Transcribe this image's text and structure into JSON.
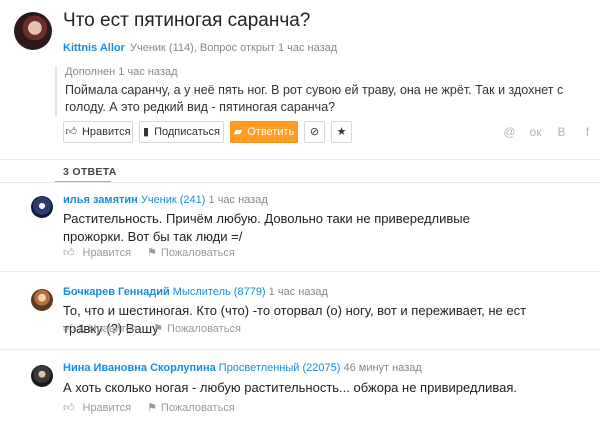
{
  "question": {
    "title": "Что ест пятиногая саранча?",
    "author": "Kittnis Allor",
    "meta": "Ученик (114), Вопрос открыт 1 час назад",
    "added_when": "Дополнен 1 час назад",
    "added_text": "Поймала саранчу, а у неё пять ног. В рот сувою ей траву, она не жрёт. Так и здохнет с голоду. А это редкий вид - пятиногая саранча?"
  },
  "actions": {
    "like": "Нравится",
    "subscribe": "Подписаться",
    "answer": "Ответить"
  },
  "share_icons": [
    "@",
    "ок",
    "В",
    "f"
  ],
  "answers_tab": "3 ОТВЕТА",
  "answers": [
    {
      "name": "илья замятин",
      "rank": "Ученик (241)",
      "time": "1 час назад",
      "text": "Растительность. Причём любую. Довольно таки не привередливые прожорки. Вот бы так люди =/",
      "like_count": "",
      "like_label": "Нравится",
      "report_label": "Пожаловаться"
    },
    {
      "name": "Бочкарев Геннадий",
      "rank": "Мыслитель (8779)",
      "time": "1 час назад",
      "text": "То, что и шестиногая. Кто (что) -то оторвал (о) ногу, вот и переживает, не ест травку (?) Вашу",
      "like_count": "1",
      "like_label": "Нравится",
      "report_label": "Пожаловаться"
    },
    {
      "name": "Нина Ивановна Скорлупина",
      "rank": "Просветленный (22075)",
      "time": "46 минут назад",
      "text": "А хоть сколько ногая - любую растительность... обжора не привиредливая.",
      "like_count": "",
      "like_label": "Нравится",
      "report_label": "Пожаловаться"
    }
  ]
}
